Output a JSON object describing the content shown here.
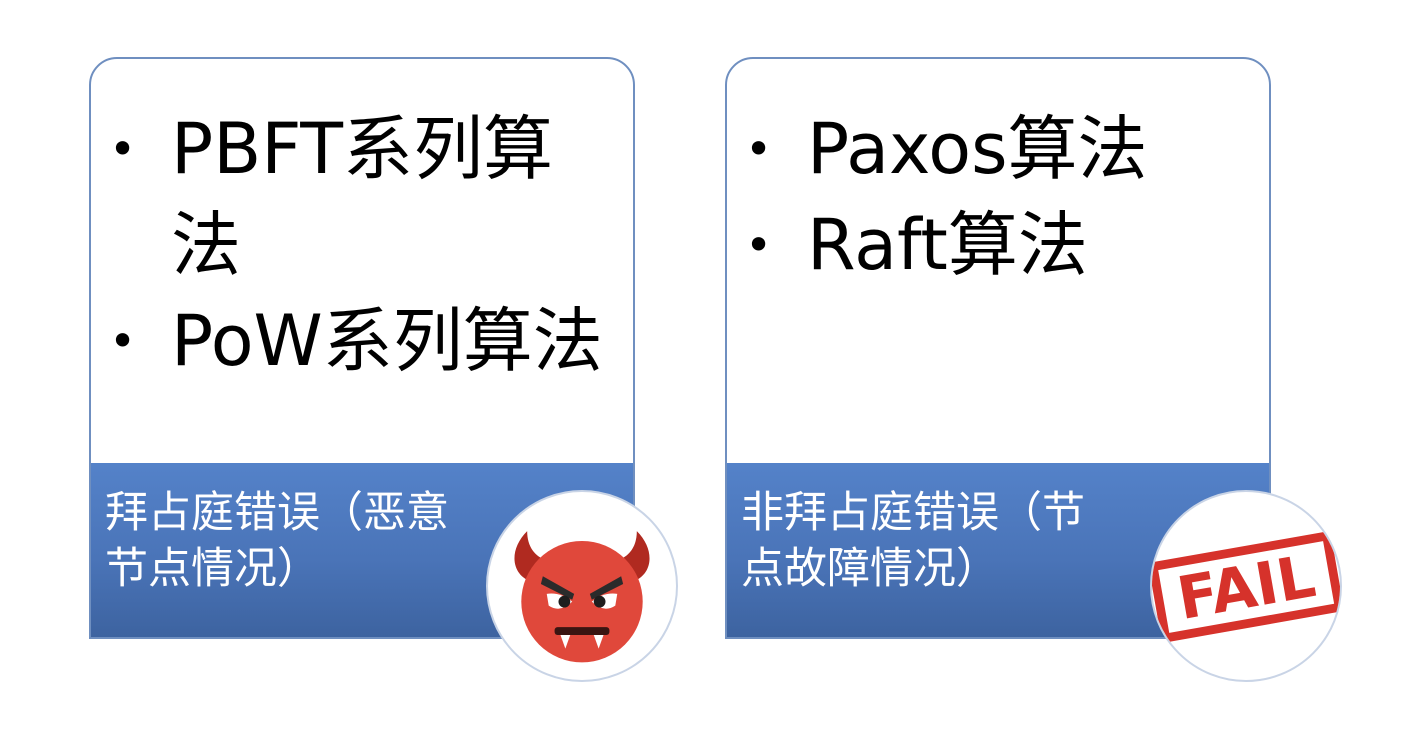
{
  "cards": [
    {
      "items": [
        "PBFT系列算法",
        "PoW系列算法"
      ],
      "footer": "拜占庭错误（恶意节点情况）",
      "badge_icon": "devil-icon"
    },
    {
      "items": [
        "Paxos算法",
        "Raft算法"
      ],
      "footer": "非拜占庭错误（节点故障情况）",
      "badge_icon": "fail-stamp-icon"
    }
  ],
  "bullet": "•",
  "fail_stamp_text": "FAIL",
  "colors": {
    "card_border": "#6f8fc0",
    "footer_top": "#5482c9",
    "footer_bottom": "#3d63a0",
    "devil_red": "#e0483b",
    "devil_horn": "#b02a20",
    "stamp_red": "#d6322b"
  }
}
